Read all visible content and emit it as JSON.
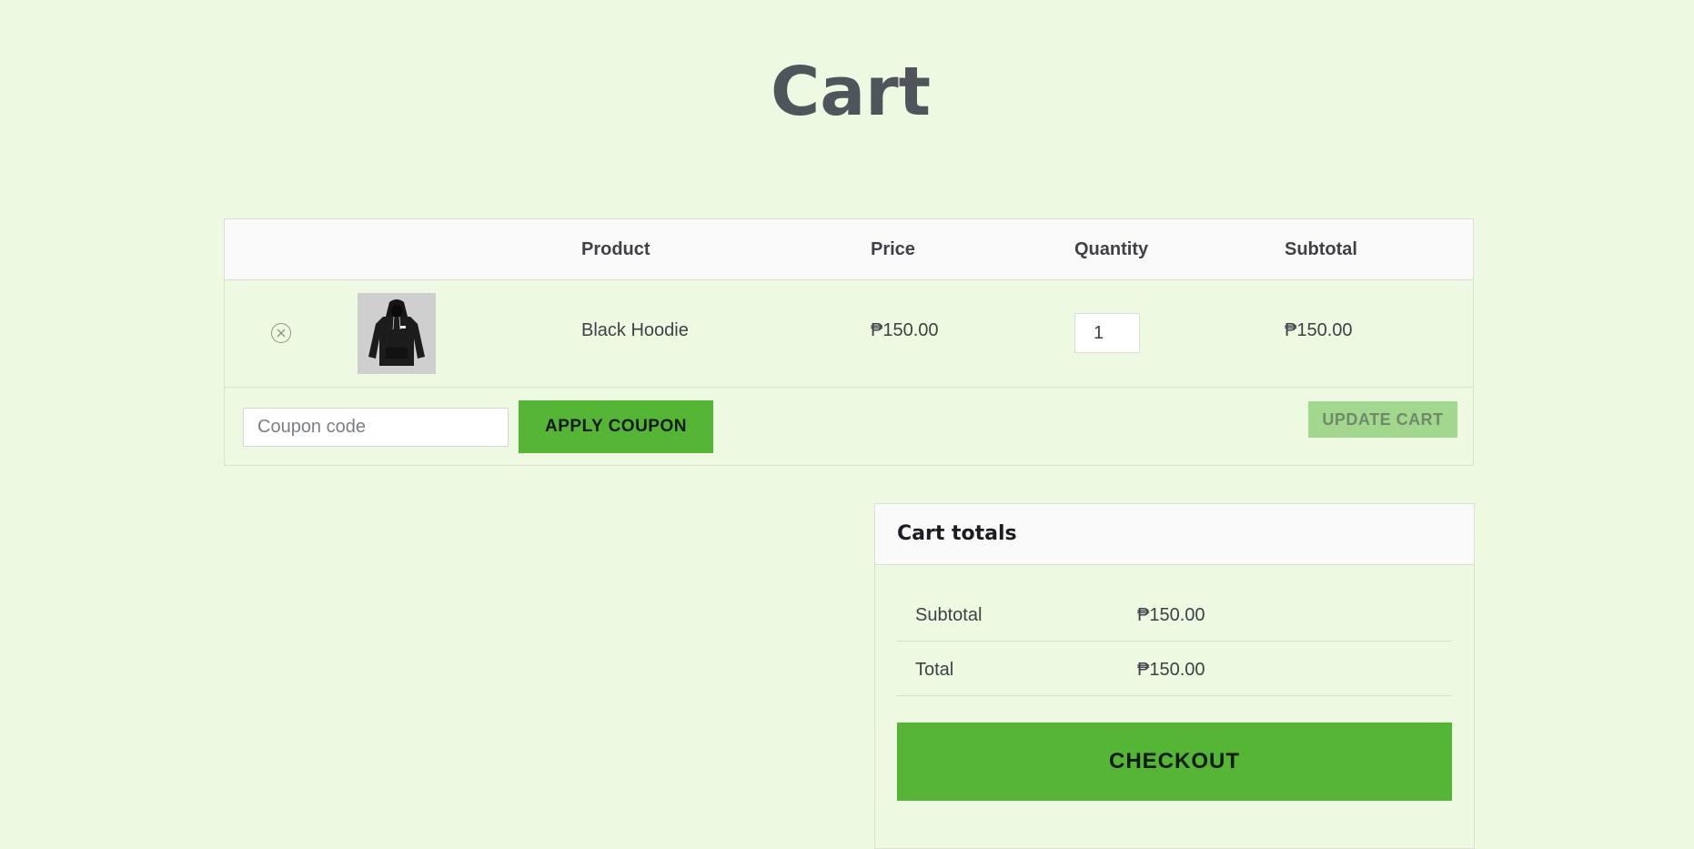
{
  "page": {
    "title": "Cart"
  },
  "cart_table": {
    "headers": {
      "product": "Product",
      "price": "Price",
      "quantity": "Quantity",
      "subtotal": "Subtotal"
    },
    "items": [
      {
        "name": "Black Hoodie",
        "price": "₱150.00",
        "quantity": "1",
        "subtotal": "₱150.00",
        "thumbnail_icon": "hoodie-image",
        "remove_icon": "close-circle-icon"
      }
    ]
  },
  "coupon": {
    "placeholder": "Coupon code",
    "value": "",
    "apply_label": "APPLY COUPON"
  },
  "update_cart_label": "UPDATE CART",
  "cart_totals": {
    "title": "Cart totals",
    "subtotal_label": "Subtotal",
    "subtotal_value": "₱150.00",
    "total_label": "Total",
    "total_value": "₱150.00",
    "checkout_label": "CHECKOUT"
  },
  "colors": {
    "background": "#edf9e0",
    "accent": "#55b535",
    "accent_disabled": "#a2d78d",
    "heading": "#50555c"
  }
}
